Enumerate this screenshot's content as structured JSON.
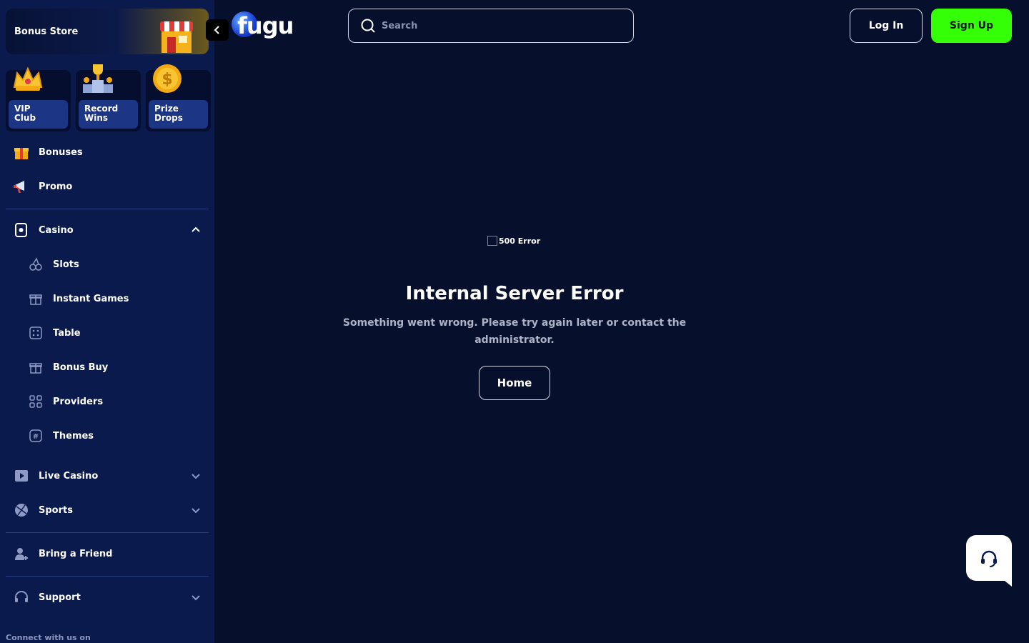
{
  "sidebar": {
    "bonus_store": "Bonus Store",
    "tiles": [
      {
        "label": "VIP\nClub",
        "icon": "crown-icon"
      },
      {
        "label": "Record\nWins",
        "icon": "trophy-icon"
      },
      {
        "label": "Prize\nDrops",
        "icon": "coin-icon"
      }
    ],
    "items": {
      "bonuses": "Bonuses",
      "promo": "Promo",
      "casino": "Casino",
      "slots": "Slots",
      "instant_games": "Instant Games",
      "table": "Table",
      "bonus_buy": "Bonus Buy",
      "providers": "Providers",
      "themes": "Themes",
      "live_casino": "Live Casino",
      "sports": "Sports",
      "bring_friend": "Bring a Friend",
      "support": "Support"
    },
    "connect": "Connect with us on"
  },
  "header": {
    "logo": "fugu",
    "search_placeholder": "Search",
    "login": "Log In",
    "signup": "Sign Up"
  },
  "error": {
    "image_alt": "500 Error",
    "title": "Internal Server Error",
    "description": "Something went wrong. Please try again later or contact the administrator.",
    "home_button": "Home"
  },
  "colors": {
    "background": "#060f2c",
    "sidebar": "#0b1a4d",
    "signup": "#35ff07",
    "tile_label": "#1c3584"
  }
}
